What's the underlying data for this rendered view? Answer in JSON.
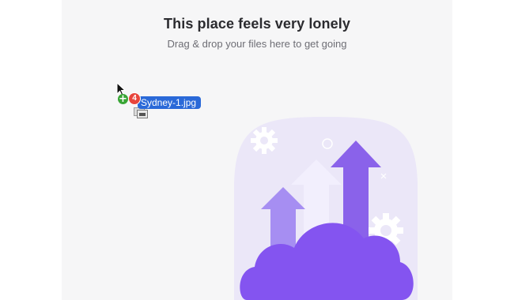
{
  "empty_state": {
    "title": "This place feels very lonely",
    "subtitle": "Drag & drop your files here to get going",
    "illustration": "cloud-upload-illustration"
  },
  "drag_ghost": {
    "file_name": "Sydney-1.jpg",
    "item_count": "4",
    "copy_badge": "+",
    "cursor": "arrow-cursor-icon"
  },
  "colors": {
    "dropzone_bg": "#f6f6f7",
    "illustration_bg": "#ebe7f8",
    "cloud": "#8454f0",
    "arrow_dark": "#8a62ea",
    "arrow_mid": "#a68ef2",
    "arrow_light": "#f2effd",
    "gear": "#ffffff",
    "chip": "#2a69d8",
    "count_badge": "#e8453c",
    "copy_badge": "#38a535"
  }
}
